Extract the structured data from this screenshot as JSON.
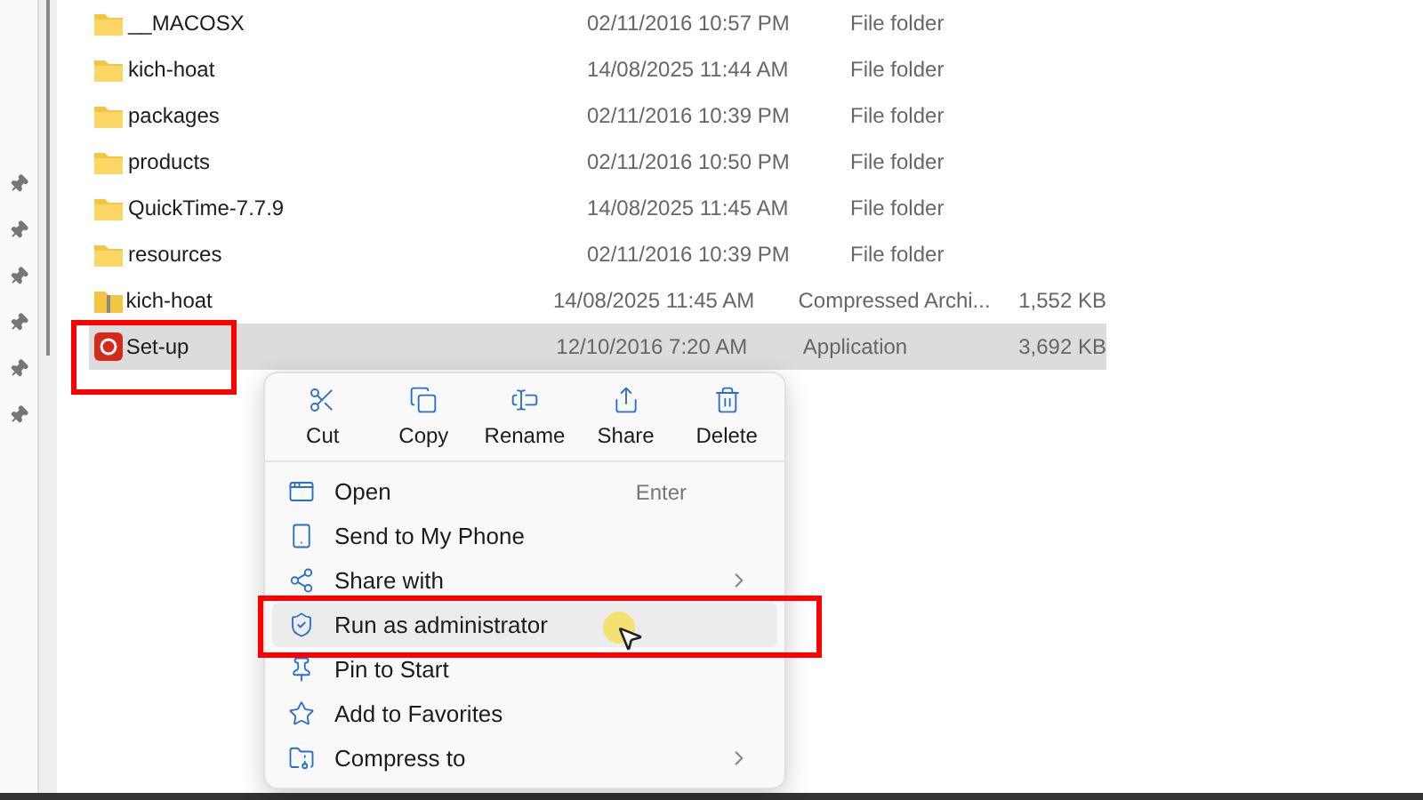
{
  "files": [
    {
      "name": "__MACOSX",
      "date": "02/11/2016 10:57 PM",
      "type": "File folder",
      "kind": "folder",
      "selected": false
    },
    {
      "name": "kich-hoat",
      "date": "14/08/2025 11:44 AM",
      "type": "File folder",
      "kind": "folder",
      "selected": false
    },
    {
      "name": "packages",
      "date": "02/11/2016 10:39 PM",
      "type": "File folder",
      "kind": "folder",
      "selected": false
    },
    {
      "name": "products",
      "date": "02/11/2016 10:50 PM",
      "type": "File folder",
      "kind": "folder",
      "selected": false
    },
    {
      "name": "QuickTime-7.7.9",
      "date": "14/08/2025 11:45 AM",
      "type": "File folder",
      "kind": "folder",
      "selected": false
    },
    {
      "name": "resources",
      "date": "02/11/2016 10:39 PM",
      "type": "File folder",
      "kind": "folder",
      "selected": false
    },
    {
      "name": "kich-hoat",
      "date": "14/08/2025 11:45 AM",
      "type": "Compressed Archi...",
      "size": "1,552 KB",
      "kind": "archive",
      "selected": false
    },
    {
      "name": "Set-up",
      "date": "12/10/2016 7:20 AM",
      "type": "Application",
      "size": "3,692 KB",
      "kind": "app",
      "selected": true
    }
  ],
  "context_menu": {
    "actions": [
      {
        "label": "Cut"
      },
      {
        "label": "Copy"
      },
      {
        "label": "Rename"
      },
      {
        "label": "Share"
      },
      {
        "label": "Delete"
      }
    ],
    "items": [
      {
        "label": "Open",
        "shortcut": "Enter",
        "submenu": false,
        "selected": false
      },
      {
        "label": "Send to My Phone",
        "submenu": false,
        "selected": false
      },
      {
        "label": "Share with",
        "submenu": true,
        "selected": false
      },
      {
        "label": "Run as administrator",
        "submenu": false,
        "selected": true
      },
      {
        "label": "Pin to Start",
        "submenu": false,
        "selected": false
      },
      {
        "label": "Add to Favorites",
        "submenu": false,
        "selected": false
      },
      {
        "label": "Compress to",
        "submenu": true,
        "selected": false
      }
    ]
  }
}
